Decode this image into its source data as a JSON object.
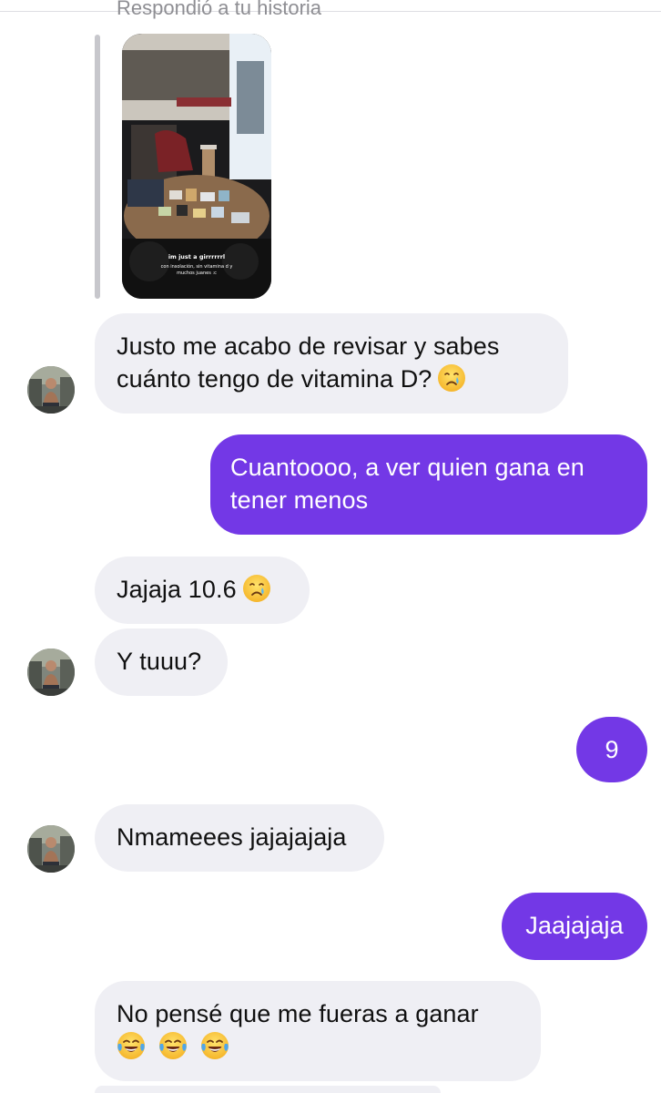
{
  "conversation": {
    "story_reply": {
      "caption": "Respondió a tu historia",
      "story_text_line1": "im just a girrrrrrl",
      "story_text_line2": "con insolación, sin vitamina d y muchos juanes :c"
    },
    "messages": [
      {
        "from": "them",
        "text": "Justo me acabo de revisar y sabes cuánto tengo de vitamina D?",
        "emoji": "crying-face"
      },
      {
        "from": "me",
        "text": "Cuantoooo, a ver quien gana en tener menos"
      },
      {
        "from": "them",
        "text": "Jajaja 10.6",
        "emoji": "crying-face"
      },
      {
        "from": "them",
        "text": "Y tuuu?"
      },
      {
        "from": "me",
        "text": "9"
      },
      {
        "from": "them",
        "text": "Nmameees jajajajaja"
      },
      {
        "from": "me",
        "text": "Jaajajaja"
      },
      {
        "from": "them",
        "text": "No pensé que me fueras a ganar",
        "emoji": [
          "face-with-tears-of-joy",
          "face-with-tears-of-joy",
          "face-with-tears-of-joy"
        ]
      }
    ]
  },
  "colors": {
    "outgoing_bubble": "#7338e6",
    "incoming_bubble": "#efeff4",
    "secondary_text": "#8e8e93"
  }
}
